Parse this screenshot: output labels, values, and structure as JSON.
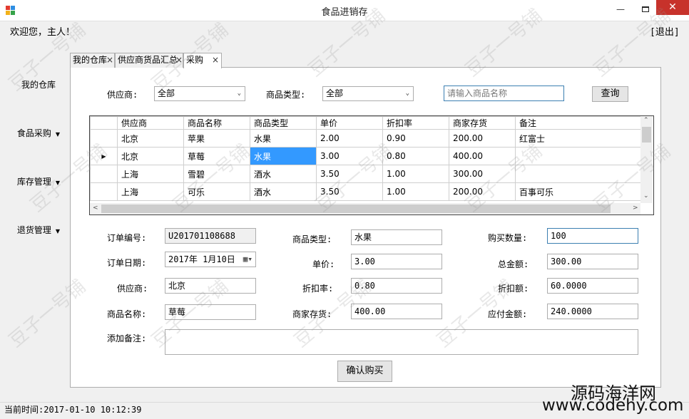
{
  "window": {
    "title": "食品进销存",
    "minimize": "—",
    "close": "✕"
  },
  "header": {
    "welcome": "欢迎您，主人！",
    "logout": "[退出]"
  },
  "sidebar": {
    "items": [
      {
        "label": "我的仓库",
        "has_caret": false
      },
      {
        "label": "食品采购",
        "has_caret": true
      },
      {
        "label": "库存管理",
        "has_caret": true
      },
      {
        "label": "退货管理",
        "has_caret": true
      }
    ],
    "caret": "▼"
  },
  "tabs": [
    {
      "label": "我的仓库",
      "close": "×"
    },
    {
      "label": "供应商货品汇总",
      "close": "×"
    },
    {
      "label": "采购",
      "close": "×"
    }
  ],
  "filter": {
    "supplier_label": "供应商:",
    "supplier_value": "全部",
    "type_label": "商品类型:",
    "type_value": "全部",
    "search_placeholder": "请输入商品名称",
    "query_button": "查询",
    "arrow": "⌄"
  },
  "grid": {
    "columns": [
      "供应商",
      "商品名称",
      "商品类型",
      "单价",
      "折扣率",
      "商家存货",
      "备注"
    ],
    "rows": [
      [
        "北京",
        "苹果",
        "水果",
        "2.00",
        "0.90",
        "200.00",
        "红富士"
      ],
      [
        "北京",
        "草莓",
        "水果",
        "3.00",
        "0.80",
        "400.00",
        ""
      ],
      [
        "上海",
        "雪碧",
        "酒水",
        "3.50",
        "1.00",
        "300.00",
        ""
      ],
      [
        "上海",
        "可乐",
        "酒水",
        "3.50",
        "1.00",
        "200.00",
        "百事可乐"
      ]
    ],
    "current_row_marker": "▶",
    "scroll_up": "⌃",
    "scroll_down": "⌄",
    "scroll_left": "<",
    "scroll_right": ">"
  },
  "form": {
    "order_no_label": "订单编号:",
    "order_no": "U201701108688",
    "order_date_label": "订单日期:",
    "order_date": "2017年 1月10日",
    "supplier_label": "供应商:",
    "supplier": "北京",
    "product_name_label": "商品名称:",
    "product_name": "草莓",
    "product_type_label": "商品类型:",
    "product_type": "水果",
    "unit_price_label": "单价:",
    "unit_price": "3.00",
    "discount_rate_label": "折扣率:",
    "discount_rate": "0.80",
    "stock_label": "商家存货:",
    "stock": "400.00",
    "quantity_label": "购买数量:",
    "quantity": "100",
    "total_label": "总金额:",
    "total": "300.00",
    "discount_amount_label": "折扣额:",
    "discount_amount": "60.0000",
    "payable_label": "应付金额:",
    "payable": "240.0000",
    "remark_label": "添加备注:",
    "remark": "",
    "confirm_button": "确认购买",
    "calendar_icon": "▦▾"
  },
  "status": {
    "text": "当前时间:2017-01-10  10:12:39"
  },
  "watermark": {
    "title": "源码海洋网",
    "url": "www.codehy.com",
    "tile": "豆子一号铺"
  },
  "colors": {
    "close_red": "#c7322b",
    "selection_blue": "#3399ff",
    "focus_border": "#3c7fb1"
  }
}
